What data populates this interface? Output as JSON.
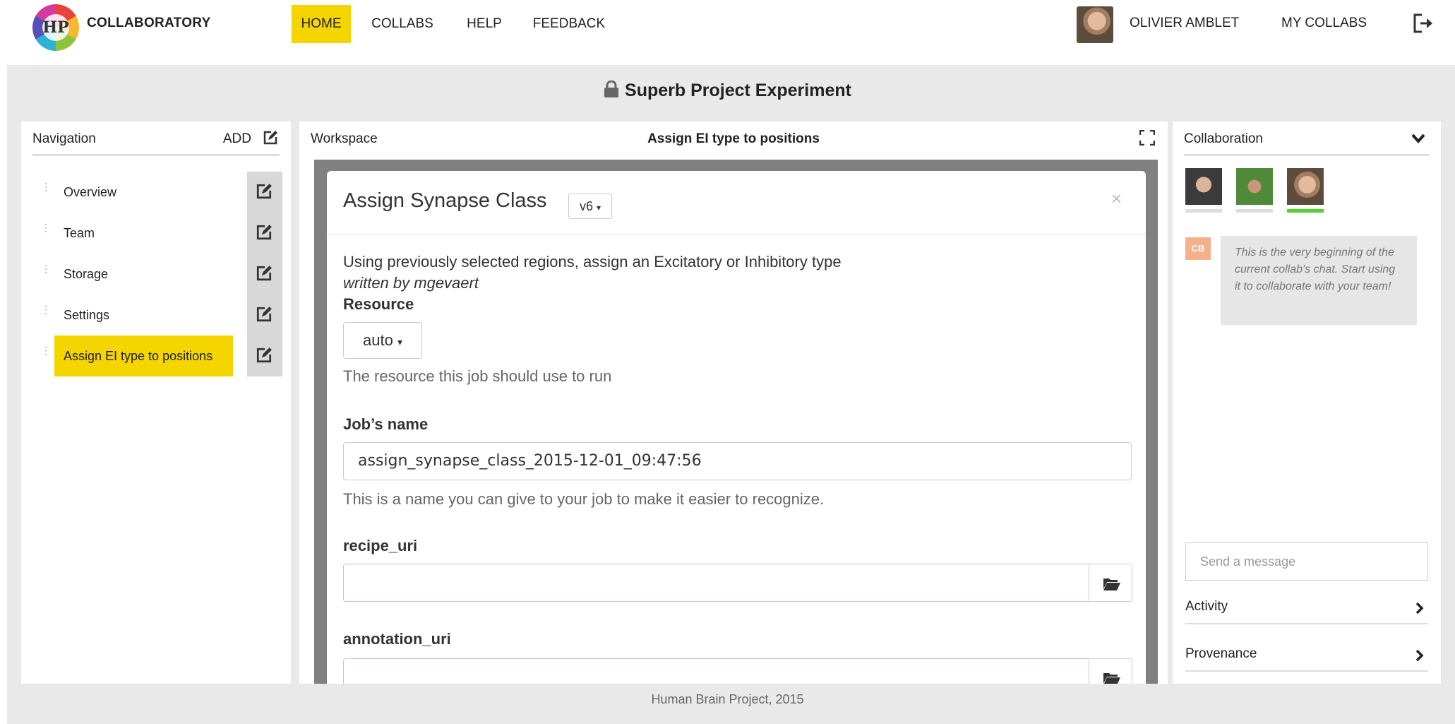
{
  "app": {
    "brand": "COLLABORATORY",
    "logo_text": "HP"
  },
  "topnav": {
    "items": [
      "HOME",
      "COLLABS",
      "HELP",
      "FEEDBACK"
    ],
    "active": "HOME"
  },
  "user": {
    "name": "OLIVIER AMBLET",
    "my_collabs": "MY COLLABS"
  },
  "project": {
    "title": "Superb Project Experiment"
  },
  "navigation": {
    "title": "Navigation",
    "add_label": "ADD",
    "items": [
      {
        "label": "Overview"
      },
      {
        "label": "Team"
      },
      {
        "label": "Storage"
      },
      {
        "label": "Settings"
      },
      {
        "label": "Assign EI type to positions",
        "active": true
      }
    ]
  },
  "workspace": {
    "label": "Workspace",
    "title": "Assign EI type to positions",
    "modal": {
      "title": "Assign Synapse Class",
      "version": "v6",
      "close": "×",
      "description": "Using previously selected regions, assign an Excitatory or Inhibitory type",
      "author": "written by mgevaert",
      "resource_label": "Resource",
      "resource_value": "auto",
      "resource_help": "The resource this job should use to run",
      "job_name_label": "Job’s name",
      "job_name_value": "assign_synapse_class_2015-12-01_09:47:56",
      "job_name_help": "This is a name you can give to your job to make it easier to recognize.",
      "recipe_label": "recipe_uri",
      "recipe_value": "",
      "annotation_label": "annotation_uri",
      "annotation_value": ""
    }
  },
  "collaboration": {
    "title": "Collaboration",
    "avatars": [
      {
        "name": "member-1",
        "online": false
      },
      {
        "name": "member-2",
        "online": false
      },
      {
        "name": "member-3",
        "online": true
      }
    ],
    "chat_badge": "CB",
    "chat_message": "This is the very beginning of the current collab's chat. Start using it to collaborate with your team!",
    "message_placeholder": "Send a message",
    "sections": [
      "Activity",
      "Provenance"
    ]
  },
  "footer": {
    "text": "Human Brain Project, 2015"
  },
  "colors": {
    "accent": "#f4d500",
    "online": "#4fd22b",
    "badge": "#f6b08a"
  }
}
